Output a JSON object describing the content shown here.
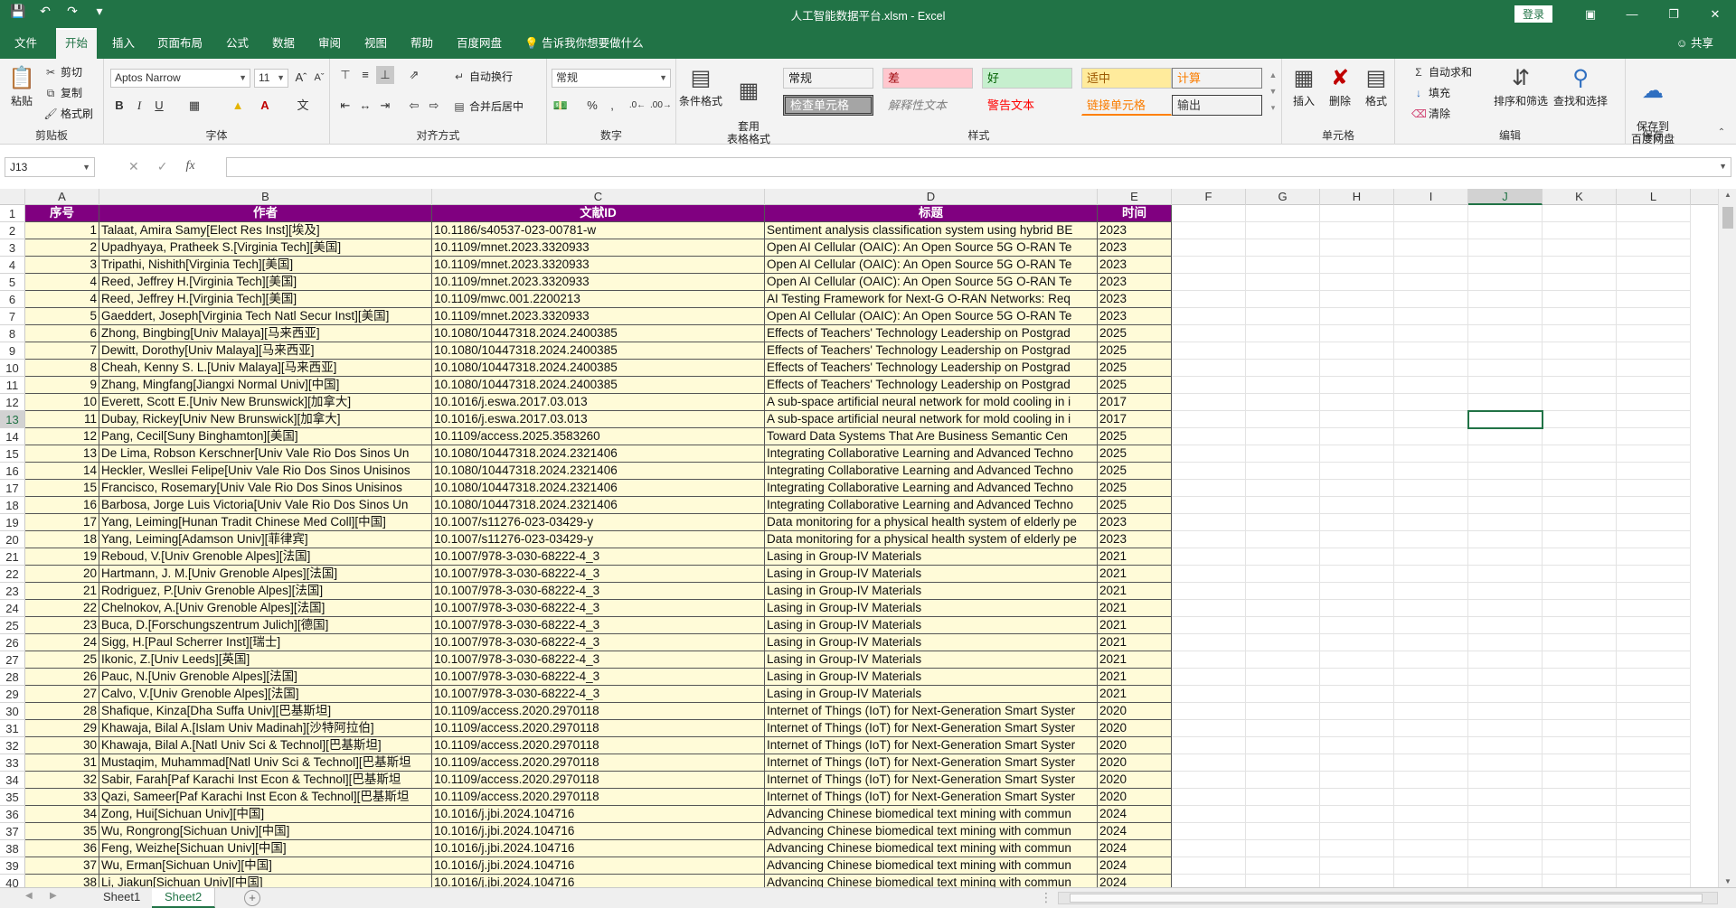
{
  "window": {
    "title": "人工智能数据平台.xlsm  -  Excel",
    "login_label": "登录",
    "share_label": "共享"
  },
  "ribbon_tabs": [
    "文件",
    "开始",
    "插入",
    "页面布局",
    "公式",
    "数据",
    "审阅",
    "视图",
    "帮助",
    "百度网盘"
  ],
  "tell_me": "告诉我你想要做什么",
  "clipboard": {
    "paste": "粘贴",
    "cut": "剪切",
    "copy": "复制",
    "format_painter": "格式刷",
    "group_label": "剪贴板"
  },
  "font": {
    "name": "Aptos Narrow",
    "size": "11",
    "group_label": "字体"
  },
  "alignment": {
    "wrap": "自动换行",
    "merge": "合并后居中",
    "group_label": "对齐方式"
  },
  "number": {
    "format": "常规",
    "group_label": "数字"
  },
  "styles": {
    "cond_format": "条件格式",
    "format_table": "套用\n表格格式",
    "cells": [
      {
        "label": "常规",
        "bg": "#ffffff",
        "fg": "#000000"
      },
      {
        "label": "差",
        "bg": "#ffc7ce",
        "fg": "#9c0006"
      },
      {
        "label": "好",
        "bg": "#c6efce",
        "fg": "#006100"
      },
      {
        "label": "适中",
        "bg": "#ffeb9c",
        "fg": "#9c5700"
      },
      {
        "label": "计算",
        "bg": "#f2f2f2",
        "fg": "#fa7d00"
      },
      {
        "label": "检查单元格",
        "bg": "#a5a5a5",
        "fg": "#ffffff"
      },
      {
        "label": "解释性文本",
        "bg": "#ffffff",
        "fg": "#7f7f7f"
      },
      {
        "label": "警告文本",
        "bg": "#ffffff",
        "fg": "#ff0000"
      },
      {
        "label": "链接单元格",
        "bg": "#ffffff",
        "fg": "#fa7d00"
      },
      {
        "label": "输出",
        "bg": "#f2f2f2",
        "fg": "#3f3f3f"
      }
    ],
    "group_label": "样式"
  },
  "cells_group": {
    "insert": "插入",
    "delete": "删除",
    "format": "格式",
    "group_label": "单元格"
  },
  "editing": {
    "autosum": "自动求和",
    "fill": "填充",
    "clear": "清除",
    "sort_filter": "排序和筛选",
    "find_select": "查找和选择",
    "group_label": "编辑"
  },
  "save_group": {
    "save_baidu": "保存到\n百度网盘",
    "group_label": "保存"
  },
  "formula_bar": {
    "name_box": "J13",
    "formula": ""
  },
  "columns": [
    "A",
    "B",
    "C",
    "D",
    "E",
    "F",
    "G",
    "H",
    "I",
    "J",
    "K",
    "L"
  ],
  "header": [
    "序号",
    "作者",
    "文献ID",
    "标题",
    "时间"
  ],
  "rows": [
    [
      "1",
      "Talaat, Amira Samy[Elect Res Inst][埃及]",
      "10.1186/s40537-023-00781-w",
      "Sentiment analysis classification system using hybrid BE",
      "2023"
    ],
    [
      "2",
      "Upadhyaya, Pratheek S.[Virginia Tech][美国]",
      "10.1109/mnet.2023.3320933",
      "Open AI Cellular (OAIC): An Open Source 5G O-RAN Te",
      "2023"
    ],
    [
      "3",
      "Tripathi, Nishith[Virginia Tech][美国]",
      "10.1109/mnet.2023.3320933",
      "Open AI Cellular (OAIC): An Open Source 5G O-RAN Te",
      "2023"
    ],
    [
      "4",
      "Reed, Jeffrey H.[Virginia Tech][美国]",
      "10.1109/mnet.2023.3320933",
      "Open AI Cellular (OAIC): An Open Source 5G O-RAN Te",
      "2023"
    ],
    [
      "4",
      "Reed, Jeffrey H.[Virginia Tech][美国]",
      "10.1109/mwc.001.2200213",
      "AI Testing Framework for Next-G O-RAN Networks: Req",
      "2023"
    ],
    [
      "5",
      "Gaeddert, Joseph[Virginia Tech Natl Secur Inst][美国]",
      "10.1109/mnet.2023.3320933",
      "Open AI Cellular (OAIC): An Open Source 5G O-RAN Te",
      "2023"
    ],
    [
      "6",
      "Zhong, Bingbing[Univ Malaya][马来西亚]",
      "10.1080/10447318.2024.2400385",
      "Effects of Teachers' Technology Leadership on Postgrad",
      "2025"
    ],
    [
      "7",
      "Dewitt, Dorothy[Univ Malaya][马来西亚]",
      "10.1080/10447318.2024.2400385",
      "Effects of Teachers' Technology Leadership on Postgrad",
      "2025"
    ],
    [
      "8",
      "Cheah, Kenny S. L.[Univ Malaya][马来西亚]",
      "10.1080/10447318.2024.2400385",
      "Effects of Teachers' Technology Leadership on Postgrad",
      "2025"
    ],
    [
      "9",
      "Zhang, Mingfang[Jiangxi Normal Univ][中国]",
      "10.1080/10447318.2024.2400385",
      "Effects of Teachers' Technology Leadership on Postgrad",
      "2025"
    ],
    [
      "10",
      "Everett, Scott E.[Univ New Brunswick][加拿大]",
      "10.1016/j.eswa.2017.03.013",
      "A sub-space artificial neural network for mold cooling in i",
      "2017"
    ],
    [
      "11",
      "Dubay, Rickey[Univ New Brunswick][加拿大]",
      "10.1016/j.eswa.2017.03.013",
      "A sub-space artificial neural network for mold cooling in i",
      "2017"
    ],
    [
      "12",
      "Pang, Cecil[Suny Binghamton][美国]",
      "10.1109/access.2025.3583260",
      "Toward Data Systems That Are Business Semantic Cen",
      "2025"
    ],
    [
      "13",
      "De Lima, Robson Kerschner[Univ Vale Rio Dos Sinos Un",
      "10.1080/10447318.2024.2321406",
      "Integrating Collaborative Learning and Advanced Techno",
      "2025"
    ],
    [
      "14",
      "Heckler, Wesllei Felipe[Univ Vale Rio Dos Sinos Unisinos",
      "10.1080/10447318.2024.2321406",
      "Integrating Collaborative Learning and Advanced Techno",
      "2025"
    ],
    [
      "15",
      "Francisco, Rosemary[Univ Vale Rio Dos Sinos Unisinos",
      "10.1080/10447318.2024.2321406",
      "Integrating Collaborative Learning and Advanced Techno",
      "2025"
    ],
    [
      "16",
      "Barbosa, Jorge Luis Victoria[Univ Vale Rio Dos Sinos Un",
      "10.1080/10447318.2024.2321406",
      "Integrating Collaborative Learning and Advanced Techno",
      "2025"
    ],
    [
      "17",
      "Yang, Leiming[Hunan Tradit Chinese Med Coll][中国]",
      "10.1007/s11276-023-03429-y",
      "Data monitoring for a physical health system of elderly pe",
      "2023"
    ],
    [
      "18",
      "Yang, Leiming[Adamson Univ][菲律宾]",
      "10.1007/s11276-023-03429-y",
      "Data monitoring for a physical health system of elderly pe",
      "2023"
    ],
    [
      "19",
      "Reboud, V.[Univ Grenoble Alpes][法国]",
      "10.1007/978-3-030-68222-4_3",
      "Lasing in Group-IV Materials",
      "2021"
    ],
    [
      "20",
      "Hartmann, J. M.[Univ Grenoble Alpes][法国]",
      "10.1007/978-3-030-68222-4_3",
      "Lasing in Group-IV Materials",
      "2021"
    ],
    [
      "21",
      "Rodriguez, P.[Univ Grenoble Alpes][法国]",
      "10.1007/978-3-030-68222-4_3",
      "Lasing in Group-IV Materials",
      "2021"
    ],
    [
      "22",
      "Chelnokov, A.[Univ Grenoble Alpes][法国]",
      "10.1007/978-3-030-68222-4_3",
      "Lasing in Group-IV Materials",
      "2021"
    ],
    [
      "23",
      "Buca, D.[Forschungszentrum Julich][德国]",
      "10.1007/978-3-030-68222-4_3",
      "Lasing in Group-IV Materials",
      "2021"
    ],
    [
      "24",
      "Sigg, H.[Paul Scherrer Inst][瑞士]",
      "10.1007/978-3-030-68222-4_3",
      "Lasing in Group-IV Materials",
      "2021"
    ],
    [
      "25",
      "Ikonic, Z.[Univ Leeds][英国]",
      "10.1007/978-3-030-68222-4_3",
      "Lasing in Group-IV Materials",
      "2021"
    ],
    [
      "26",
      "Pauc, N.[Univ Grenoble Alpes][法国]",
      "10.1007/978-3-030-68222-4_3",
      "Lasing in Group-IV Materials",
      "2021"
    ],
    [
      "27",
      "Calvo, V.[Univ Grenoble Alpes][法国]",
      "10.1007/978-3-030-68222-4_3",
      "Lasing in Group-IV Materials",
      "2021"
    ],
    [
      "28",
      "Shafique, Kinza[Dha Suffa Univ][巴基斯坦]",
      "10.1109/access.2020.2970118",
      "Internet of Things (IoT) for Next-Generation Smart Syster",
      "2020"
    ],
    [
      "29",
      "Khawaja, Bilal A.[Islam Univ Madinah][沙特阿拉伯]",
      "10.1109/access.2020.2970118",
      "Internet of Things (IoT) for Next-Generation Smart Syster",
      "2020"
    ],
    [
      "30",
      "Khawaja, Bilal A.[Natl Univ Sci & Technol][巴基斯坦]",
      "10.1109/access.2020.2970118",
      "Internet of Things (IoT) for Next-Generation Smart Syster",
      "2020"
    ],
    [
      "31",
      "Mustaqim, Muhammad[Natl Univ Sci & Technol][巴基斯坦",
      "10.1109/access.2020.2970118",
      "Internet of Things (IoT) for Next-Generation Smart Syster",
      "2020"
    ],
    [
      "32",
      "Sabir, Farah[Paf Karachi Inst Econ & Technol][巴基斯坦",
      "10.1109/access.2020.2970118",
      "Internet of Things (IoT) for Next-Generation Smart Syster",
      "2020"
    ],
    [
      "33",
      "Qazi, Sameer[Paf Karachi Inst Econ & Technol][巴基斯坦",
      "10.1109/access.2020.2970118",
      "Internet of Things (IoT) for Next-Generation Smart Syster",
      "2020"
    ],
    [
      "34",
      "Zong, Hui[Sichuan Univ][中国]",
      "10.1016/j.jbi.2024.104716",
      "Advancing Chinese biomedical text mining with commun",
      "2024"
    ],
    [
      "35",
      "Wu, Rongrong[Sichuan Univ][中国]",
      "10.1016/j.jbi.2024.104716",
      "Advancing Chinese biomedical text mining with commun",
      "2024"
    ],
    [
      "36",
      "Feng, Weizhe[Sichuan Univ][中国]",
      "10.1016/j.jbi.2024.104716",
      "Advancing Chinese biomedical text mining with commun",
      "2024"
    ],
    [
      "37",
      "Wu, Erman[Sichuan Univ][中国]",
      "10.1016/j.jbi.2024.104716",
      "Advancing Chinese biomedical text mining with commun",
      "2024"
    ],
    [
      "38",
      "Li, Jiakun[Sichuan Univ][中国]",
      "10.1016/j.jbi.2024.104716",
      "Advancing Chinese biomedical text mining with commun",
      "2024"
    ]
  ],
  "row_numbers": [
    "1",
    "2",
    "3",
    "4",
    "5",
    "6",
    "7",
    "8",
    "9",
    "10",
    "11",
    "12",
    "13",
    "14",
    "15",
    "16",
    "17",
    "18",
    "19",
    "20",
    "21",
    "22",
    "23",
    "24",
    "25",
    "26",
    "27",
    "28",
    "29",
    "30",
    "31",
    "32",
    "33",
    "34",
    "35",
    "36",
    "37",
    "38",
    "39",
    "40"
  ],
  "selected_column": "J",
  "selected_row": "13",
  "sheets": [
    "Sheet1",
    "Sheet2"
  ],
  "active_sheet": "Sheet2",
  "colors": {
    "brand": "#217346",
    "header_fill": "#800080",
    "data_fill": "#fffbd8"
  }
}
